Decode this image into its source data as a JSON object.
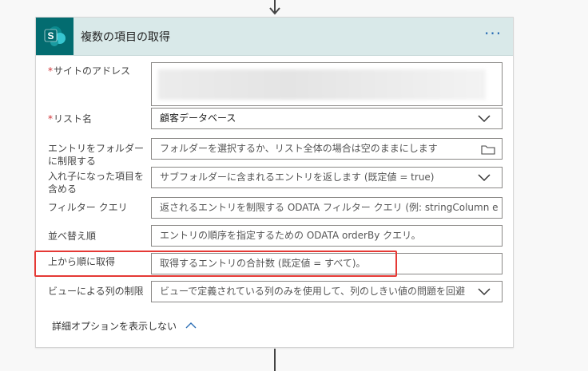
{
  "card": {
    "title": "複数の項目の取得",
    "menu_label": "···"
  },
  "fields": {
    "site_address": {
      "label": "サイトのアドレス",
      "required": "*",
      "value": ""
    },
    "list_name": {
      "label": "リスト名",
      "required": "*",
      "value": "顧客データベース"
    },
    "limit_folder": {
      "label_line1": "エントリをフォルダー",
      "label_line2": "に制限する",
      "placeholder": "フォルダーを選択するか、リスト全体の場合は空のままにします"
    },
    "nested": {
      "label_line1": "入れ子になった項目を",
      "label_line2": "含める",
      "placeholder": "サブフォルダーに含まれるエントリを返します (既定値 = true)"
    },
    "filter_query": {
      "label": "フィルター クエリ",
      "placeholder": "返されるエントリを制限する ODATA フィルター クエリ (例: stringColumn eq '"
    },
    "order_by": {
      "label": "並べ替え順",
      "placeholder": "エントリの順序を指定するための ODATA orderBy クエリ。"
    },
    "top_count": {
      "label": "上から順に取得",
      "placeholder": "取得するエントリの合計数 (既定値 = すべて)。"
    },
    "limit_columns": {
      "label": "ビューによる列の制限",
      "placeholder": "ビューで定義されている列のみを使用して、列のしきい値の問題を回避"
    }
  },
  "advanced_options": {
    "label": "詳細オプションを表示しない"
  },
  "colors": {
    "header_bg": "#d9e9e9",
    "sharepoint": "#036c70",
    "highlight": "#e53935",
    "link": "#2d6fb5"
  }
}
